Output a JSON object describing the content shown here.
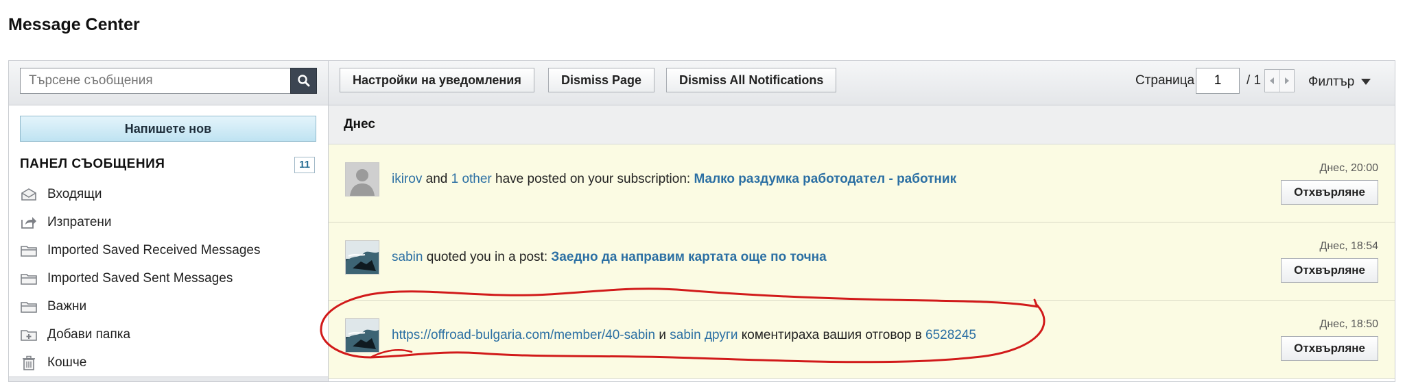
{
  "page": {
    "title": "Message Center"
  },
  "sidebar": {
    "search_placeholder": "Търсене съобщения",
    "compose_label": "Напишете нов",
    "panel_title": "ПАНЕЛ СЪОБЩЕНИЯ",
    "panel_count": "11",
    "folders": [
      {
        "label": "Входящи",
        "icon": "inbox-icon"
      },
      {
        "label": "Изпратени",
        "icon": "sent-icon"
      },
      {
        "label": "Imported Saved Received Messages",
        "icon": "folder-icon"
      },
      {
        "label": "Imported Saved Sent Messages",
        "icon": "folder-icon"
      },
      {
        "label": "Важни",
        "icon": "folder-icon"
      },
      {
        "label": "Добави папка",
        "icon": "add-folder-icon"
      },
      {
        "label": "Кошче",
        "icon": "trash-icon"
      }
    ]
  },
  "toolbar": {
    "settings_label": "Настройки на уведомления",
    "dismiss_page_label": "Dismiss Page",
    "dismiss_all_label": "Dismiss All Notifications",
    "page_label": "Страница",
    "page_value": "1",
    "page_total": "/ 1",
    "filter_label": "Филтър"
  },
  "day_header": "Днес",
  "notifications": [
    {
      "user": "ikirov",
      "and": "and",
      "other": "1 other",
      "text": "have posted on your subscription:",
      "topic": "Малко раздумка работодател - работник",
      "time": "Днес, 20:00",
      "action": "Отхвърляне"
    },
    {
      "user": "sabin",
      "text": "quoted you in a post:",
      "topic": "Заедно да направим картата още по точна",
      "time": "Днес, 18:54",
      "action": "Отхвърляне"
    },
    {
      "link": "https://offroad-bulgaria.com/member/40-sabin",
      "and": "и",
      "others": "sabin други",
      "text": "коментираха вашия отговор в",
      "ref": "6528245",
      "time": "Днес, 18:50",
      "action": "Отхвърляне"
    }
  ],
  "colors": {
    "link": "#2b6fa3",
    "highlight_row": "#fbfbe3",
    "annotation": "#d11a1a"
  }
}
